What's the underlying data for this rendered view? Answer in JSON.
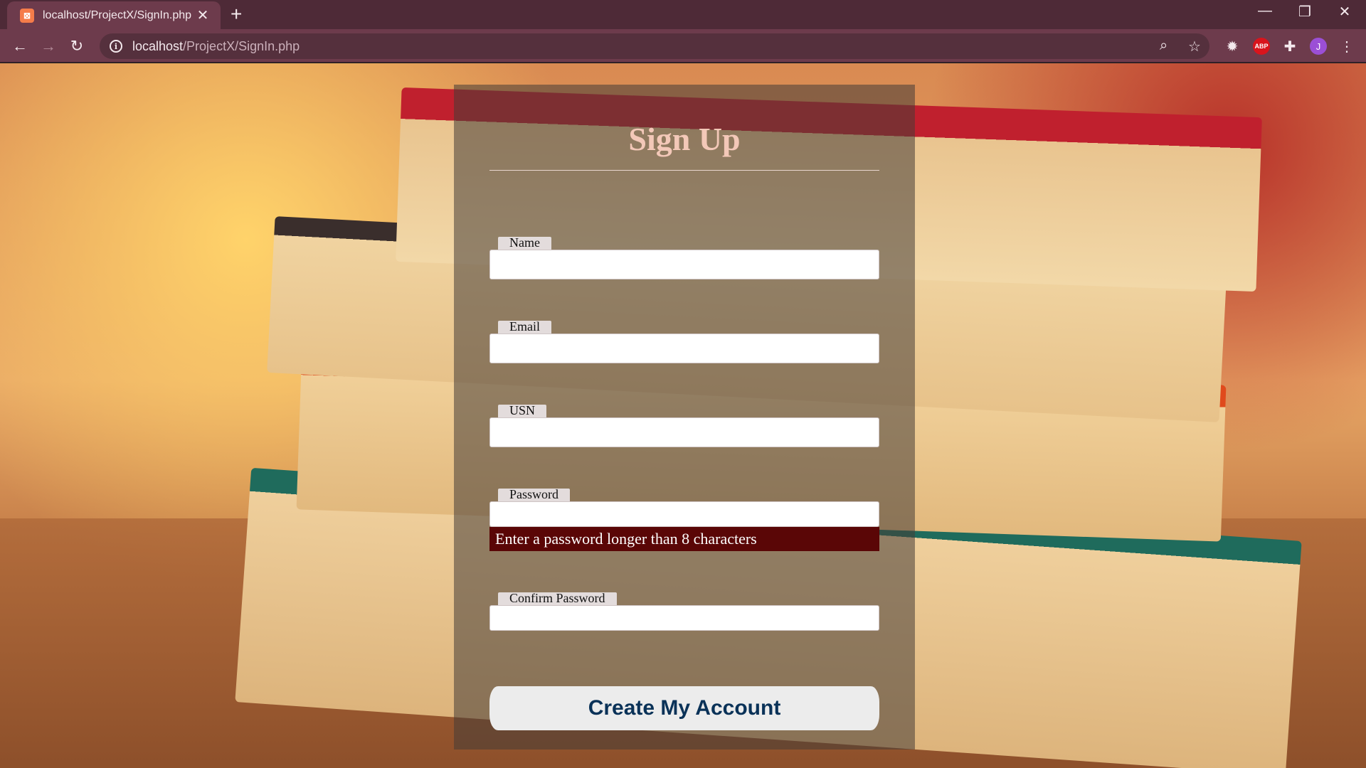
{
  "browser": {
    "tab_title": "localhost/ProjectX/SignIn.php",
    "favicon_letter": "⊠",
    "url_host": "localhost",
    "url_path": "/ProjectX/SignIn.php",
    "ext_abp": "ABP",
    "avatar_letter": "J"
  },
  "form": {
    "title": "Sign Up",
    "fields": [
      {
        "label": "Name",
        "value": ""
      },
      {
        "label": "Email",
        "value": ""
      },
      {
        "label": "USN",
        "value": ""
      },
      {
        "label": "Password",
        "value": ""
      },
      {
        "label": "Confirm Password",
        "value": ""
      }
    ],
    "password_hint": "Enter a password longer than 8 characters",
    "submit_label": "Create My Account"
  }
}
